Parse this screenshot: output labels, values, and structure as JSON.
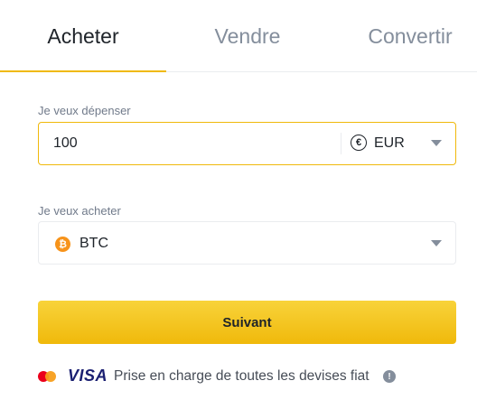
{
  "tabs": [
    {
      "label": "Acheter"
    },
    {
      "label": "Vendre"
    },
    {
      "label": "Convertir"
    }
  ],
  "spend": {
    "label": "Je veux dépenser",
    "amount": "100",
    "currency_symbol": "€",
    "currency": "EUR",
    "currency_icon": "euro-icon"
  },
  "buy": {
    "label": "Je veux acheter",
    "currency_symbol": "₿",
    "currency": "BTC",
    "currency_icon": "bitcoin-icon"
  },
  "cta": {
    "label": "Suivant"
  },
  "footer": {
    "visa_text": "VISA",
    "text": "Prise en charge de toutes les devises fiat",
    "info_symbol": "!"
  },
  "colors": {
    "accent": "#f0b90b",
    "text": "#1e2329",
    "muted": "#848e9c",
    "bitcoin": "#f7931a"
  }
}
